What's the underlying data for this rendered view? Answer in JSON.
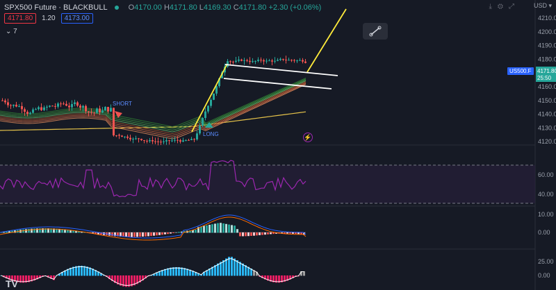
{
  "header": {
    "symbol": "SPX500 Future · BLACKBULL",
    "ohlc": {
      "o_label": "O",
      "o": "4170.00",
      "h_label": "H",
      "h": "4171.80",
      "l_label": "L",
      "l": "4169.30",
      "c_label": "C",
      "c": "4171.80",
      "change": "+2.30 (+0.06%)"
    },
    "sell_price": "4171.80",
    "spread": "1.20",
    "buy_price": "4173.00",
    "indicators_toggle": "7",
    "currency": "USD"
  },
  "price_axis": {
    "ticks": [
      "4210.00",
      "4200.00",
      "4190.00",
      "4180.00",
      "4170.00",
      "4160.00",
      "4150.00",
      "4140.00",
      "4130.00",
      "4120.00"
    ],
    "symbol_tag": "US500.F",
    "last_price": "4171.80",
    "countdown": "25:50"
  },
  "rsi_axis": {
    "ticks": [
      "60.00",
      "40.00"
    ]
  },
  "macd_axis": {
    "ticks": [
      "10.00",
      "0.00"
    ]
  },
  "osc_axis": {
    "ticks": [
      "25.00",
      "0.00"
    ]
  },
  "annotations": {
    "short": "SHORT",
    "long": "LONG"
  },
  "colors": {
    "up": "#26a69a",
    "down": "#ef5350",
    "trend": "#ffeb3b",
    "rsi": "#9c27b0",
    "macd": "#2962ff",
    "signal": "#ff6d00",
    "bg": "#161a25"
  },
  "watermark": "TV"
}
